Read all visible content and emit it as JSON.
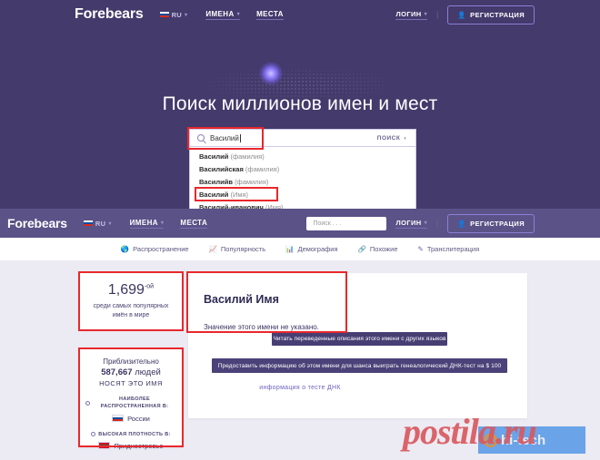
{
  "colors": {
    "hero_bg": "#443a6b",
    "subheader_bg": "#5b5287",
    "content_bg": "#eceaf2",
    "accent_button": "#473f73",
    "highlight_red": "#e8282c",
    "link_purple": "#6e63c0"
  },
  "topnav": {
    "brand": "Forebears",
    "language": "RU",
    "links": [
      {
        "label": "ИМЕНА",
        "has_caret": true
      },
      {
        "label": "МЕСТА",
        "has_caret": false
      }
    ],
    "login_label": "ЛОГИН",
    "register_label": "РЕГИСТРАЦИЯ"
  },
  "hero": {
    "title": "Поиск миллионов имен и мест",
    "search": {
      "value": "Василий",
      "placeholder": "Поиск . . .",
      "submit_label": "ПОИСК",
      "icon": "search-icon",
      "suggestions": [
        {
          "name": "Василий",
          "kind": "(фамилия)",
          "highlighted": false
        },
        {
          "name": "Василийская",
          "kind": "(фамилия)",
          "highlighted": false
        },
        {
          "name": "Василийв",
          "kind": "(фамилия)",
          "highlighted": false
        },
        {
          "name": "Василий",
          "kind": "(Имя)",
          "highlighted": true
        },
        {
          "name": "Василий-иванович",
          "kind": "(Имя)",
          "highlighted": false
        }
      ]
    }
  },
  "subheader": {
    "brand": "Forebears",
    "language": "RU",
    "links": [
      {
        "label": "ИМЕНА",
        "has_caret": true
      },
      {
        "label": "МЕСТА",
        "has_caret": false
      }
    ],
    "search_placeholder": "Поиск . . .",
    "login_label": "ЛОГИН",
    "register_label": "РЕГИСТРАЦИЯ"
  },
  "tabs": [
    {
      "label": "Распространение",
      "icon": "globe-icon"
    },
    {
      "label": "Популярность",
      "icon": "line-chart-icon"
    },
    {
      "label": "Демография",
      "icon": "bar-chart-icon"
    },
    {
      "label": "Похожие",
      "icon": "link-icon"
    },
    {
      "label": "Транслитерация",
      "icon": "translate-icon"
    }
  ],
  "rank_card": {
    "number": "1,699",
    "suffix": "-ой",
    "description_line1": "среди самых популярных",
    "description_line2": "имён в мире"
  },
  "main_card": {
    "title": "Василий Имя",
    "description": "Значение этого имени не указано."
  },
  "actions": {
    "translate_button": "Читать переведенные описания этого имени с других языков",
    "dna_button": "Предоставить информацию об этом имени для шанса выиграть генеалогический ДНК-тест на $ 100",
    "dna_link": "информация о тесте ДНК"
  },
  "popularity_card": {
    "approx_label": "Приблизительно",
    "people_count": "587,667",
    "people_word": "людей",
    "bear_name_line": "НОСЯТ ЭТО ИМЯ",
    "most_common_label": "НАИБОЛЕЕ РАСПРОСТРАНЕННАЯ В:",
    "most_common_country": "России",
    "most_common_flag": "flag-russia-icon",
    "density_label": "ВЫСОКАЯ ПЛОТНОСТЬ В:",
    "density_country": "Приднестровье",
    "density_flag": "flag-transnistria-icon"
  },
  "watermarks": {
    "postila": "postila.ru",
    "hitech": "hi-tech"
  }
}
